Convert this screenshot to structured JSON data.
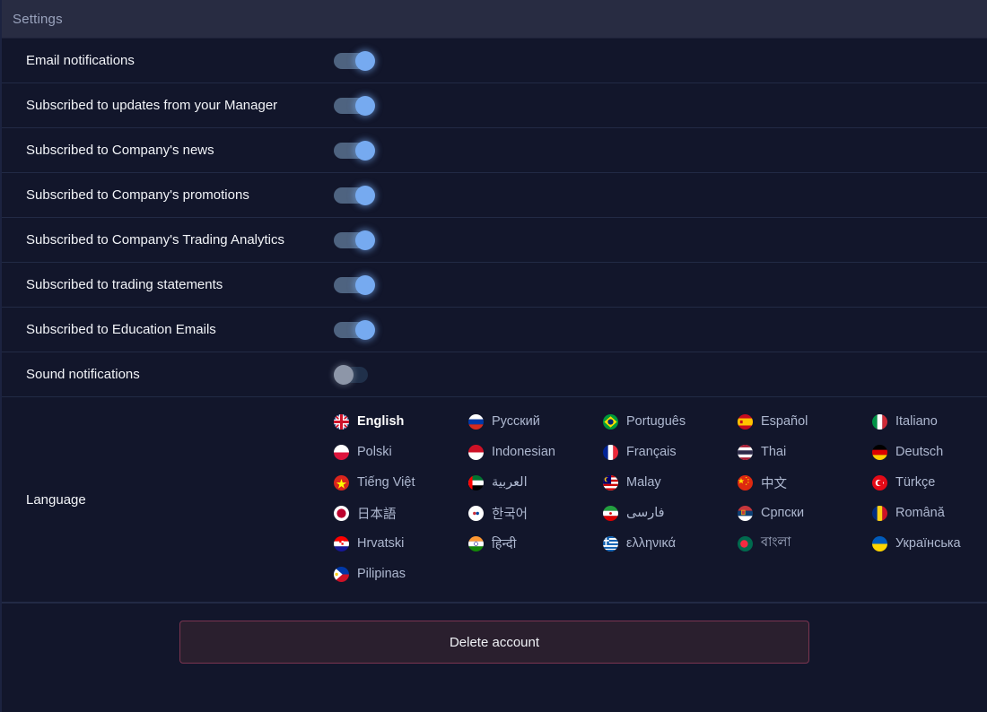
{
  "header": {
    "title": "Settings"
  },
  "colors": {
    "background": "#12162b",
    "header_background": "#282c42",
    "toggle_on": "#76aaf0",
    "toggle_off": "#8d96a8",
    "divider": "#222a45",
    "danger_border": "#7b3550",
    "danger_background": "#2a1f2e"
  },
  "settings": [
    {
      "label": "Email notifications",
      "state": "on"
    },
    {
      "label": "Subscribed to updates from your Manager",
      "state": "on"
    },
    {
      "label": "Subscribed to Company's news",
      "state": "on"
    },
    {
      "label": "Subscribed to Company's promotions",
      "state": "on"
    },
    {
      "label": "Subscribed to Company's Trading Analytics",
      "state": "on"
    },
    {
      "label": "Subscribed to trading statements",
      "state": "on"
    },
    {
      "label": "Subscribed to Education Emails",
      "state": "on"
    },
    {
      "label": "Sound notifications",
      "state": "off"
    }
  ],
  "language": {
    "label": "Language",
    "selected": "English",
    "options": [
      {
        "name": "English",
        "flag": "flag-uk",
        "selected": true
      },
      {
        "name": "Русский",
        "flag": "flag-russia",
        "selected": false
      },
      {
        "name": "Português",
        "flag": "flag-brazil",
        "selected": false
      },
      {
        "name": "Español",
        "flag": "flag-spain",
        "selected": false
      },
      {
        "name": "Italiano",
        "flag": "flag-italy",
        "selected": false
      },
      {
        "name": "Polski",
        "flag": "flag-poland",
        "selected": false
      },
      {
        "name": "Indonesian",
        "flag": "flag-indonesia",
        "selected": false
      },
      {
        "name": "Français",
        "flag": "flag-france",
        "selected": false
      },
      {
        "name": "Thai",
        "flag": "flag-thailand",
        "selected": false
      },
      {
        "name": "Deutsch",
        "flag": "flag-germany",
        "selected": false
      },
      {
        "name": "Tiếng Việt",
        "flag": "flag-vietnam",
        "selected": false
      },
      {
        "name": "العربية",
        "flag": "flag-uae",
        "selected": false
      },
      {
        "name": "Malay",
        "flag": "flag-malaysia",
        "selected": false
      },
      {
        "name": "中文",
        "flag": "flag-china",
        "selected": false
      },
      {
        "name": "Türkçe",
        "flag": "flag-turkey",
        "selected": false
      },
      {
        "name": "日本語",
        "flag": "flag-japan",
        "selected": false
      },
      {
        "name": "한국어",
        "flag": "flag-southkorea",
        "selected": false
      },
      {
        "name": "فارسی",
        "flag": "flag-iran",
        "selected": false
      },
      {
        "name": "Српски",
        "flag": "flag-serbia",
        "selected": false
      },
      {
        "name": "Română",
        "flag": "flag-romania",
        "selected": false
      },
      {
        "name": "Hrvatski",
        "flag": "flag-croatia",
        "selected": false
      },
      {
        "name": "हिन्दी",
        "flag": "flag-india",
        "selected": false
      },
      {
        "name": "ελληνικά",
        "flag": "flag-greece",
        "selected": false
      },
      {
        "name": "বাংলা",
        "flag": "flag-bangladesh",
        "selected": false
      },
      {
        "name": "Українська",
        "flag": "flag-ukraine",
        "selected": false
      },
      {
        "name": "Pilipinas",
        "flag": "flag-philippines",
        "selected": false
      }
    ]
  },
  "footer": {
    "delete_label": "Delete account"
  }
}
